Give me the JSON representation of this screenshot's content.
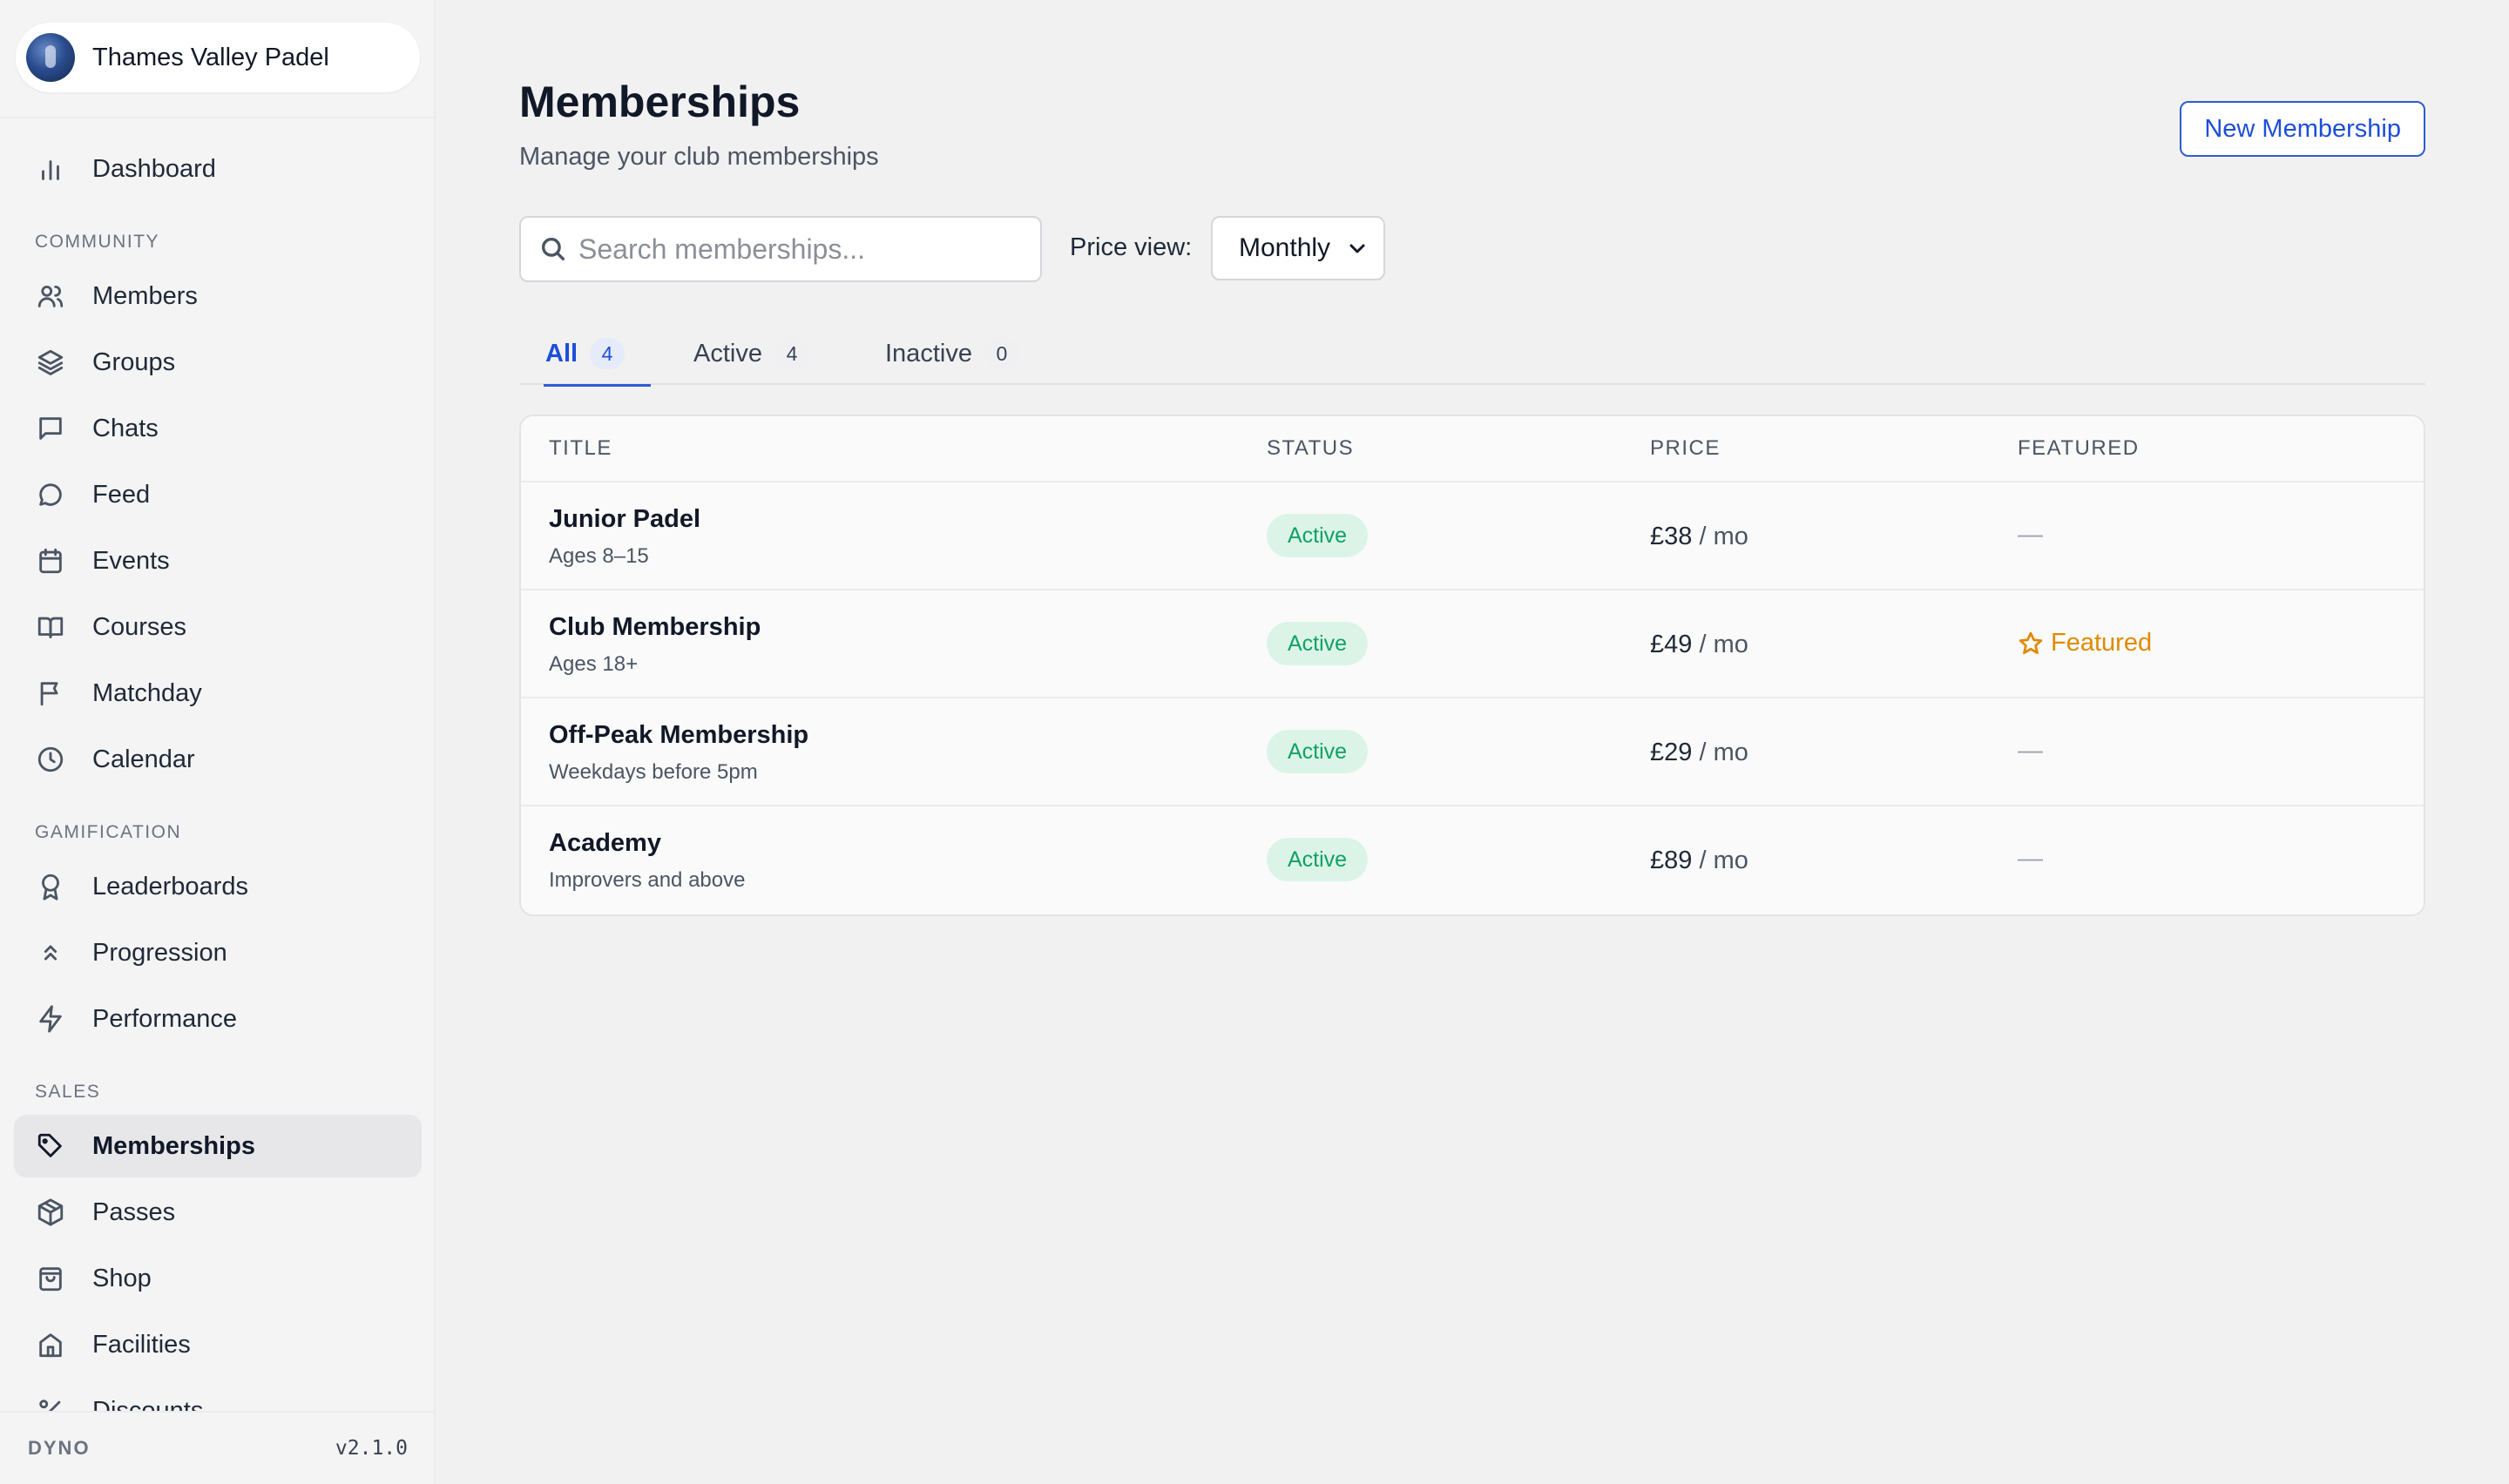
{
  "club": {
    "name": "Thames Valley Padel"
  },
  "nav": {
    "dashboard": {
      "label": "Dashboard",
      "icon": "bar-chart-icon"
    },
    "community_label": "COMMUNITY",
    "members": {
      "label": "Members",
      "icon": "users-icon"
    },
    "groups": {
      "label": "Groups",
      "icon": "layers-icon"
    },
    "chats": {
      "label": "Chats",
      "icon": "chat-square-icon"
    },
    "feed": {
      "label": "Feed",
      "icon": "chat-bubble-icon"
    },
    "events": {
      "label": "Events",
      "icon": "calendar-icon"
    },
    "courses": {
      "label": "Courses",
      "icon": "book-icon"
    },
    "matchday": {
      "label": "Matchday",
      "icon": "flag-icon"
    },
    "calendar": {
      "label": "Calendar",
      "icon": "clock-icon"
    },
    "gamification_label": "GAMIFICATION",
    "leaderboards": {
      "label": "Leaderboards",
      "icon": "award-icon"
    },
    "progression": {
      "label": "Progression",
      "icon": "chevrons-up-icon"
    },
    "performance": {
      "label": "Performance",
      "icon": "lightning-icon"
    },
    "sales_label": "SALES",
    "memberships": {
      "label": "Memberships",
      "icon": "tag-icon"
    },
    "passes": {
      "label": "Passes",
      "icon": "package-icon"
    },
    "shop": {
      "label": "Shop",
      "icon": "shopping-bag-icon"
    },
    "facilities": {
      "label": "Facilities",
      "icon": "home-icon"
    },
    "discounts": {
      "label": "Discounts",
      "icon": "percent-icon"
    }
  },
  "footer": {
    "brand": "DYNO",
    "version": "v2.1.0"
  },
  "header": {
    "title": "Memberships",
    "subtitle": "Manage your club memberships",
    "new_button": "New Membership"
  },
  "filters": {
    "search_placeholder": "Search memberships...",
    "price_view_label": "Price view:",
    "price_view_value": "Monthly"
  },
  "tabs": [
    {
      "label": "All",
      "count": "4"
    },
    {
      "label": "Active",
      "count": "4"
    },
    {
      "label": "Inactive",
      "count": "0"
    }
  ],
  "table": {
    "columns": {
      "title": "TITLE",
      "status": "STATUS",
      "price": "PRICE",
      "featured": "FEATURED"
    },
    "rows": [
      {
        "title": "Junior Padel",
        "subtitle": "Ages 8–15",
        "status": "Active",
        "price": "£38",
        "unit": "/ mo",
        "featured": "—"
      },
      {
        "title": "Club Membership",
        "subtitle": "Ages 18+",
        "status": "Active",
        "price": "£49",
        "unit": "/ mo",
        "featured": "Featured"
      },
      {
        "title": "Off-Peak Membership",
        "subtitle": "Weekdays before 5pm",
        "status": "Active",
        "price": "£29",
        "unit": "/ mo",
        "featured": "—"
      },
      {
        "title": "Academy",
        "subtitle": "Improvers and above",
        "status": "Active",
        "price": "£89",
        "unit": "/ mo",
        "featured": "—"
      }
    ]
  },
  "colors": {
    "accent": "#1d4ed8",
    "active_badge_bg": "#dcf4e8",
    "active_badge_text": "#10a163",
    "featured": "#e08a00"
  }
}
